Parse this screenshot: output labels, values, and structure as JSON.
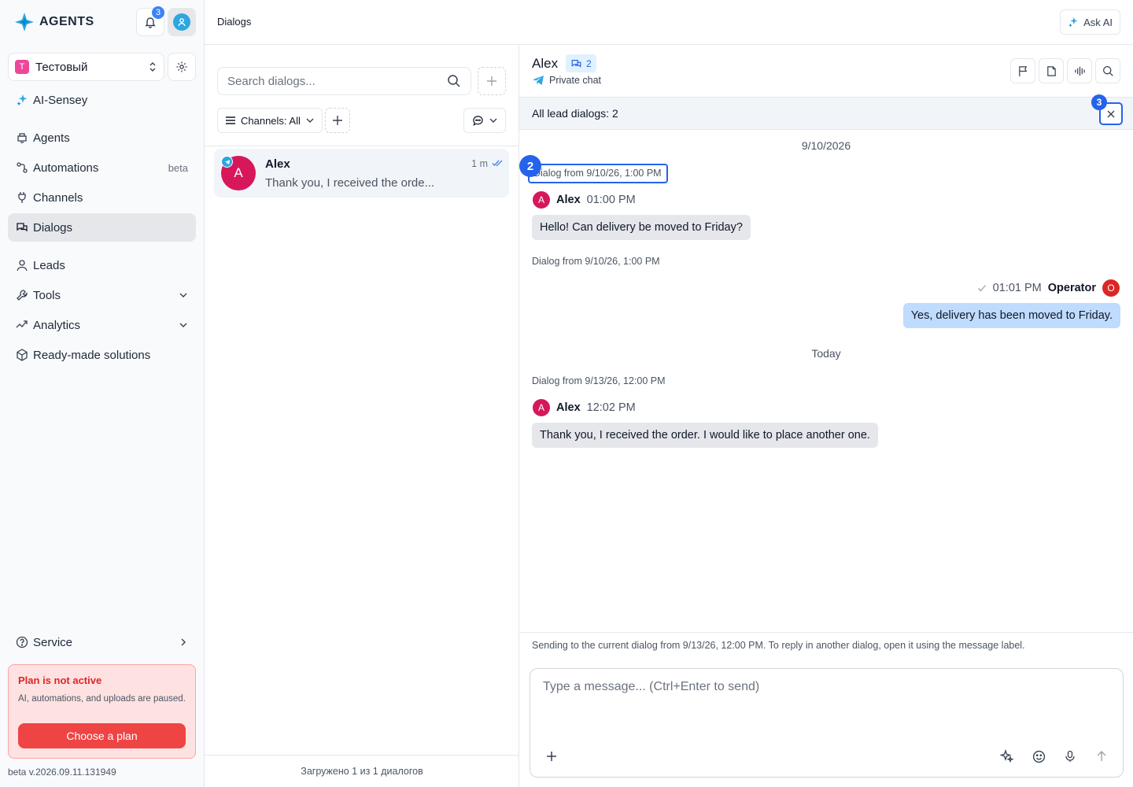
{
  "app": {
    "logo_text": "AGENTS",
    "notifications_count": "3"
  },
  "sidebar": {
    "workspace": {
      "initial": "Т",
      "name": "Тестовый"
    },
    "items": [
      {
        "label": "AI-Sensey",
        "icon": "sparkle-icon",
        "tag": ""
      },
      {
        "label": "Agents",
        "icon": "agent-icon",
        "tag": ""
      },
      {
        "label": "Automations",
        "icon": "workflow-icon",
        "tag": "beta"
      },
      {
        "label": "Channels",
        "icon": "plug-icon",
        "tag": ""
      },
      {
        "label": "Dialogs",
        "icon": "chat-icon",
        "tag": "",
        "active": true
      },
      {
        "label": "Leads",
        "icon": "user-icon",
        "tag": ""
      },
      {
        "label": "Tools",
        "icon": "wrench-icon",
        "tag": ""
      },
      {
        "label": "Analytics",
        "icon": "chart-icon",
        "tag": ""
      },
      {
        "label": "Ready-made solutions",
        "icon": "box-icon",
        "tag": ""
      }
    ],
    "service_label": "Service",
    "plan": {
      "title": "Plan is not active",
      "description": "AI, automations, and uploads are paused.",
      "button": "Choose a plan"
    },
    "version": "beta v.2026.09.11.131949"
  },
  "topbar": {
    "breadcrumb": "Dialogs",
    "ask_ai": "Ask AI"
  },
  "dialog_list": {
    "search_placeholder": "Search dialogs...",
    "channels_filter": "Channels: All",
    "items": [
      {
        "initial": "A",
        "name": "Alex",
        "time": "1 m",
        "preview": "Thank you, I received the orde..."
      }
    ],
    "footer": "Загружено 1 из 1 диалогов"
  },
  "chat": {
    "contact_name": "Alex",
    "dialogs_count": "2",
    "chat_type": "Private chat",
    "lead_dialogs": "All lead dialogs: 2",
    "markers": {
      "close": "3",
      "label": "2"
    },
    "date_1": "9/10/2026",
    "date_2": "Today",
    "dialog_label_1": "Dialog from 9/10/26, 1:00 PM",
    "dialog_label_2": "Dialog from 9/10/26, 1:00 PM",
    "dialog_label_3": "Dialog from 9/13/26, 12:00 PM",
    "messages": [
      {
        "sender": "Alex",
        "initial": "A",
        "time": "01:00 PM",
        "text": "Hello! Can delivery be moved to Friday?"
      },
      {
        "sender": "Operator",
        "initial": "O",
        "time": "01:01 PM",
        "text": "Yes, delivery has been moved to Friday."
      },
      {
        "sender": "Alex",
        "initial": "A",
        "time": "12:02 PM",
        "text": "Thank you, I received the order. I would like to place another one."
      }
    ],
    "composer_hint": "Sending to the current dialog from 9/13/26, 12:00 PM. To reply in another dialog, open it using the message label.",
    "composer_placeholder": "Type a message... (Ctrl+Enter to send)"
  },
  "colors": {
    "accent": "#2563eb",
    "telegram": "#2ea6df",
    "lead_avatar": "#d6185b",
    "operator_avatar": "#dc2626",
    "plan_red": "#ef4444"
  }
}
